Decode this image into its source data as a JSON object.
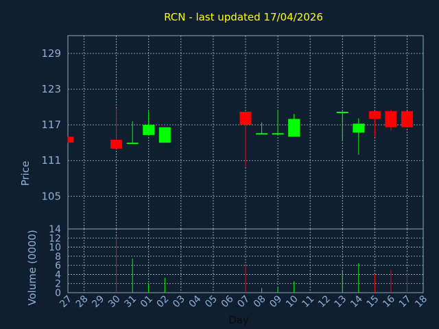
{
  "colors": {
    "background": "#0f1f30",
    "frame": "#8fa8c0",
    "grid": "#b8c4d0",
    "text": "#8fb0d8",
    "title": "#ffff00",
    "up": "#00ff00",
    "down": "#ff0000"
  },
  "chart_data": {
    "type": "candlestick",
    "title": "RCN - last updated 17/04/2026",
    "xlabel": "Day",
    "price_panel": {
      "ylabel": "Price",
      "yticks": [
        105,
        111,
        117,
        123,
        129
      ],
      "ylim": [
        99.5,
        132.0
      ],
      "grid": true
    },
    "volume_panel": {
      "ylabel": "Volume (0000)",
      "yticks": [
        0,
        2,
        4,
        6,
        8,
        10,
        12,
        14
      ],
      "ylim": [
        0,
        14
      ],
      "grid": true
    },
    "x_ticks": [
      "27",
      "28",
      "29",
      "30",
      "31",
      "01",
      "02",
      "03",
      "04",
      "05",
      "06",
      "07",
      "08",
      "09",
      "10",
      "11",
      "12",
      "13",
      "14",
      "15",
      "16",
      "17",
      "18"
    ],
    "candles": [
      {
        "x": "27",
        "open": 115.0,
        "high": 115.0,
        "low": 114.0,
        "close": 114.0,
        "volume": 0.0
      },
      {
        "x": "30",
        "open": 114.5,
        "high": 119.8,
        "low": 113.0,
        "close": 113.0,
        "volume": 12.5
      },
      {
        "x": "31",
        "open": 113.8,
        "high": 117.6,
        "low": 113.8,
        "close": 114.0,
        "volume": 7.5
      },
      {
        "x": "01",
        "open": 115.3,
        "high": 119.3,
        "low": 115.3,
        "close": 117.0,
        "volume": 2.0
      },
      {
        "x": "02",
        "open": 114.0,
        "high": 116.6,
        "low": 114.0,
        "close": 116.6,
        "volume": 3.3
      },
      {
        "x": "07",
        "open": 119.2,
        "high": 119.2,
        "low": 109.9,
        "close": 117.0,
        "volume": 6.0
      },
      {
        "x": "08",
        "open": 115.5,
        "high": 117.4,
        "low": 115.5,
        "close": 115.6,
        "volume": 1.0
      },
      {
        "x": "09",
        "open": 115.5,
        "high": 119.5,
        "low": 115.5,
        "close": 115.6,
        "volume": 1.3
      },
      {
        "x": "10",
        "open": 115.0,
        "high": 118.8,
        "low": 115.0,
        "close": 118.0,
        "volume": 2.5
      },
      {
        "x": "13",
        "open": 119.0,
        "high": 119.3,
        "low": 114.3,
        "close": 119.2,
        "volume": 4.8
      },
      {
        "x": "14",
        "open": 115.7,
        "high": 118.1,
        "low": 112.0,
        "close": 117.2,
        "volume": 6.5
      },
      {
        "x": "15",
        "open": 119.3,
        "high": 119.3,
        "low": 115.0,
        "close": 118.0,
        "volume": 4.0
      },
      {
        "x": "16",
        "open": 119.3,
        "high": 119.6,
        "low": 116.0,
        "close": 116.6,
        "volume": 5.0
      },
      {
        "x": "17",
        "open": 119.3,
        "high": 119.3,
        "low": 116.6,
        "close": 116.6,
        "volume": 4.3
      }
    ]
  }
}
